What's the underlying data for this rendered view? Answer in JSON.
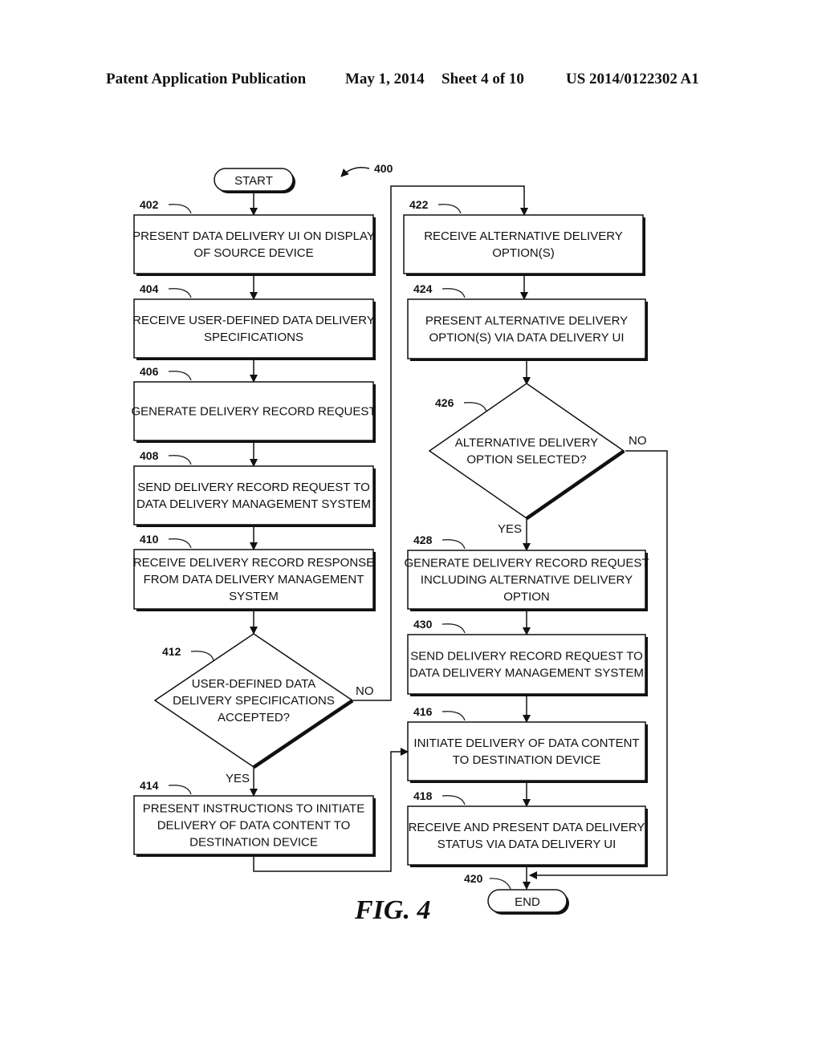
{
  "header": {
    "publication": "Patent Application Publication",
    "date": "May 1, 2014",
    "sheet": "Sheet 4 of 10",
    "number": "US 2014/0122302 A1"
  },
  "figure": {
    "label": "FIG. 4",
    "ref": "400",
    "start": "START",
    "end": "END",
    "end_ref": "420",
    "yes": "YES",
    "no": "NO",
    "steps": {
      "s402": {
        "ref": "402",
        "lines": [
          "PRESENT DATA DELIVERY UI ON DISPLAY",
          "OF SOURCE DEVICE"
        ]
      },
      "s404": {
        "ref": "404",
        "lines": [
          "RECEIVE USER-DEFINED DATA DELIVERY",
          "SPECIFICATIONS"
        ]
      },
      "s406": {
        "ref": "406",
        "lines": [
          "GENERATE DELIVERY RECORD REQUEST"
        ]
      },
      "s408": {
        "ref": "408",
        "lines": [
          "SEND DELIVERY RECORD REQUEST TO",
          "DATA DELIVERY MANAGEMENT SYSTEM"
        ]
      },
      "s410": {
        "ref": "410",
        "lines": [
          "RECEIVE DELIVERY RECORD RESPONSE",
          "FROM DATA DELIVERY MANAGEMENT",
          "SYSTEM"
        ]
      },
      "s412": {
        "ref": "412",
        "lines": [
          "USER-DEFINED DATA",
          "DELIVERY SPECIFICATIONS",
          "ACCEPTED?"
        ]
      },
      "s414": {
        "ref": "414",
        "lines": [
          "PRESENT INSTRUCTIONS TO INITIATE",
          "DELIVERY OF DATA CONTENT TO",
          "DESTINATION DEVICE"
        ]
      },
      "s422": {
        "ref": "422",
        "lines": [
          "RECEIVE ALTERNATIVE DELIVERY",
          "OPTION(S)"
        ]
      },
      "s424": {
        "ref": "424",
        "lines": [
          "PRESENT ALTERNATIVE DELIVERY",
          "OPTION(S) VIA DATA DELIVERY UI"
        ]
      },
      "s426": {
        "ref": "426",
        "lines": [
          "ALTERNATIVE DELIVERY",
          "OPTION SELECTED?"
        ]
      },
      "s428": {
        "ref": "428",
        "lines": [
          "GENERATE DELIVERY RECORD REQUEST",
          "INCLUDING ALTERNATIVE DELIVERY",
          "OPTION"
        ]
      },
      "s430": {
        "ref": "430",
        "lines": [
          "SEND DELIVERY RECORD REQUEST TO",
          "DATA DELIVERY MANAGEMENT SYSTEM"
        ]
      },
      "s416": {
        "ref": "416",
        "lines": [
          "INITIATE DELIVERY OF DATA CONTENT",
          "TO DESTINATION DEVICE"
        ]
      },
      "s418": {
        "ref": "418",
        "lines": [
          "RECEIVE AND PRESENT DATA DELIVERY",
          "STATUS VIA DATA DELIVERY UI"
        ]
      }
    }
  }
}
